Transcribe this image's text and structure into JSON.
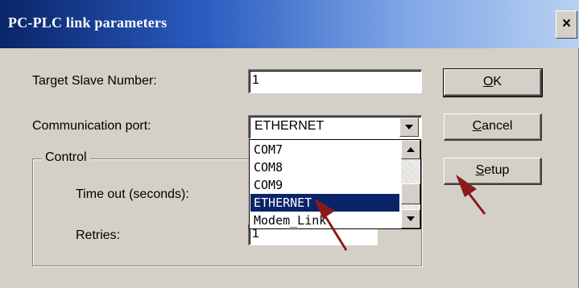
{
  "window": {
    "title": "PC-PLC link parameters",
    "close_glyph": "×"
  },
  "fields": {
    "target_slave_label": "Target Slave Number:",
    "target_slave_value": "1",
    "comm_port_label": "Communication port:",
    "comm_port_value": "ETHERNET",
    "comm_port_options": [
      "COM7",
      "COM8",
      "COM9",
      "ETHERNET",
      "Modem_Link"
    ],
    "comm_port_selected_index": 3
  },
  "control_group": {
    "legend": "Control",
    "timeout_label": "Time out (seconds):",
    "retries_label": "Retries:",
    "retries_value": "1"
  },
  "buttons": {
    "ok": {
      "mnemonic": "O",
      "rest": "K"
    },
    "cancel": {
      "mnemonic": "C",
      "rest": "ancel"
    },
    "setup": {
      "mnemonic": "S",
      "rest": "etup"
    }
  },
  "icons": {
    "dropdown": "chevron-down-icon",
    "scroll_up": "arrow-up-icon",
    "scroll_down": "arrow-down-icon",
    "close": "close-icon",
    "annotation": "red-arrow"
  },
  "colors": {
    "title_start": "#0a2468",
    "title_end": "#b9d0f2",
    "face": "#d4d0c8",
    "selection": "#0a246a",
    "annotation_arrow": "#8b1a1a"
  }
}
